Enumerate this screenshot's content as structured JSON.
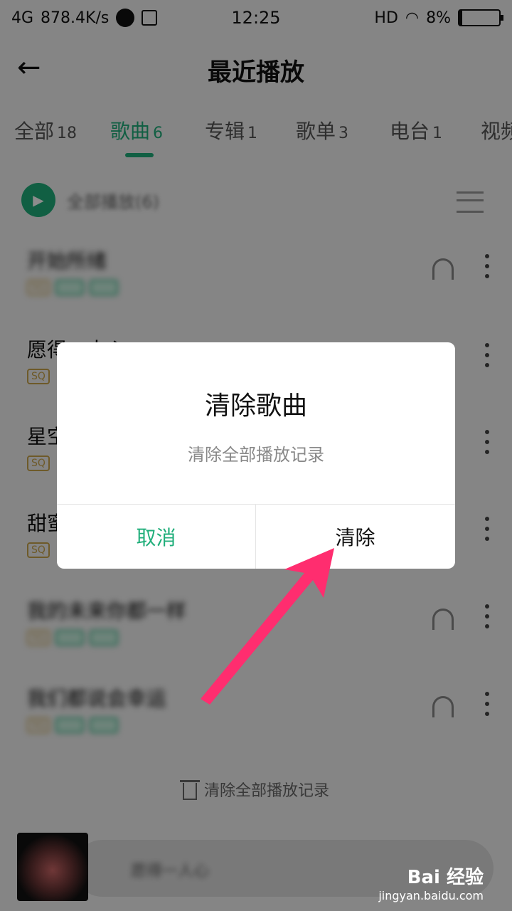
{
  "status": {
    "network": "4G",
    "speed": "878.4K/s",
    "time": "12:25",
    "hd": "HD",
    "battery": "8%"
  },
  "header": {
    "title": "最近播放"
  },
  "tabs": [
    {
      "label": "全部",
      "count": "18"
    },
    {
      "label": "歌曲",
      "count": "6"
    },
    {
      "label": "专辑",
      "count": "1"
    },
    {
      "label": "歌单",
      "count": "3"
    },
    {
      "label": "电台",
      "count": "1"
    },
    {
      "label": "视频",
      "count": ""
    }
  ],
  "list": {
    "play_all": "全部播放(6)",
    "songs": [
      {
        "name": "开始所绪",
        "tag": "SQ"
      },
      {
        "name": "愿得一人心",
        "tag": "SQ"
      },
      {
        "name": "星空",
        "tag": "SQ"
      },
      {
        "name": "甜蜜",
        "tag": "SQ"
      },
      {
        "name": "我的未来你都一样",
        "tag": "SQ"
      },
      {
        "name": "我们都说会幸运",
        "tag": "SQ"
      }
    ],
    "clear_all": "清除全部播放记录"
  },
  "player": {
    "title": "愿得一人心"
  },
  "dialog": {
    "title": "清除歌曲",
    "message": "清除全部播放记录",
    "cancel": "取消",
    "confirm": "清除"
  },
  "watermark": {
    "logo": "Bai 经验",
    "url": "jingyan.baidu.com"
  },
  "colors": {
    "accent": "#1fae7a",
    "arrow": "#ff2d6f"
  }
}
